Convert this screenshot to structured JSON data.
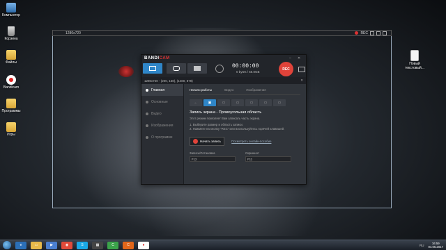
{
  "desktop": {
    "icons": [
      {
        "name": "computer-icon",
        "label": "Компьютер"
      },
      {
        "name": "recycle-bin-icon",
        "label": "Корзина"
      },
      {
        "name": "folder-icon",
        "label": "Файлы"
      },
      {
        "name": "bandicam-icon",
        "label": "Bandicam"
      },
      {
        "name": "programs-folder-icon",
        "label": "Программы"
      },
      {
        "name": "games-folder-icon",
        "label": "Игры"
      },
      {
        "name": "text-document-icon",
        "label": "Новый текстовый..."
      }
    ]
  },
  "capture_bar": {
    "resolution": "1280x720",
    "rec_label": "REC"
  },
  "bandicam": {
    "logo_main": "BANDI",
    "logo_accent": "CAM",
    "timer": "00:00:00",
    "file_size": "0 bytes / 56.0GB",
    "rec_button": "REC",
    "subbar": "1280x720 - (200, 158), (1480, 878)",
    "sidebar": [
      {
        "label": "Главная",
        "active": true
      },
      {
        "label": "Основные",
        "active": false
      },
      {
        "label": "Видео",
        "active": false
      },
      {
        "label": "Изображения",
        "active": false
      },
      {
        "label": "О программе",
        "active": false
      }
    ],
    "tabs": [
      {
        "label": "Начало работы",
        "active": true
      },
      {
        "label": "Видео",
        "active": false
      },
      {
        "label": "Изображения",
        "active": false
      }
    ],
    "mode_buttons": [
      "←",
      "▣",
      "▭",
      "▭",
      "▭",
      "▭",
      "▭"
    ],
    "heading": "Запись экрана - Прямоугольная область",
    "description": "Этот режим позволяет Вам записать часть экрана.",
    "steps": [
      "1. Выберите размер и область записи.",
      "2. Нажмите на кнопку \"REC\" или воспользуйтесь горячей клавишей."
    ],
    "start_button": "Начать запись",
    "guide_link": "Посмотреть онлайн-пособие",
    "hotkeys": [
      {
        "label": "Запись/Остановка",
        "value": "F12"
      },
      {
        "label": "Скриншот",
        "value": "F11"
      }
    ]
  },
  "taskbar": {
    "language": "RU",
    "time": "16:59",
    "date": "04.06.2017"
  }
}
